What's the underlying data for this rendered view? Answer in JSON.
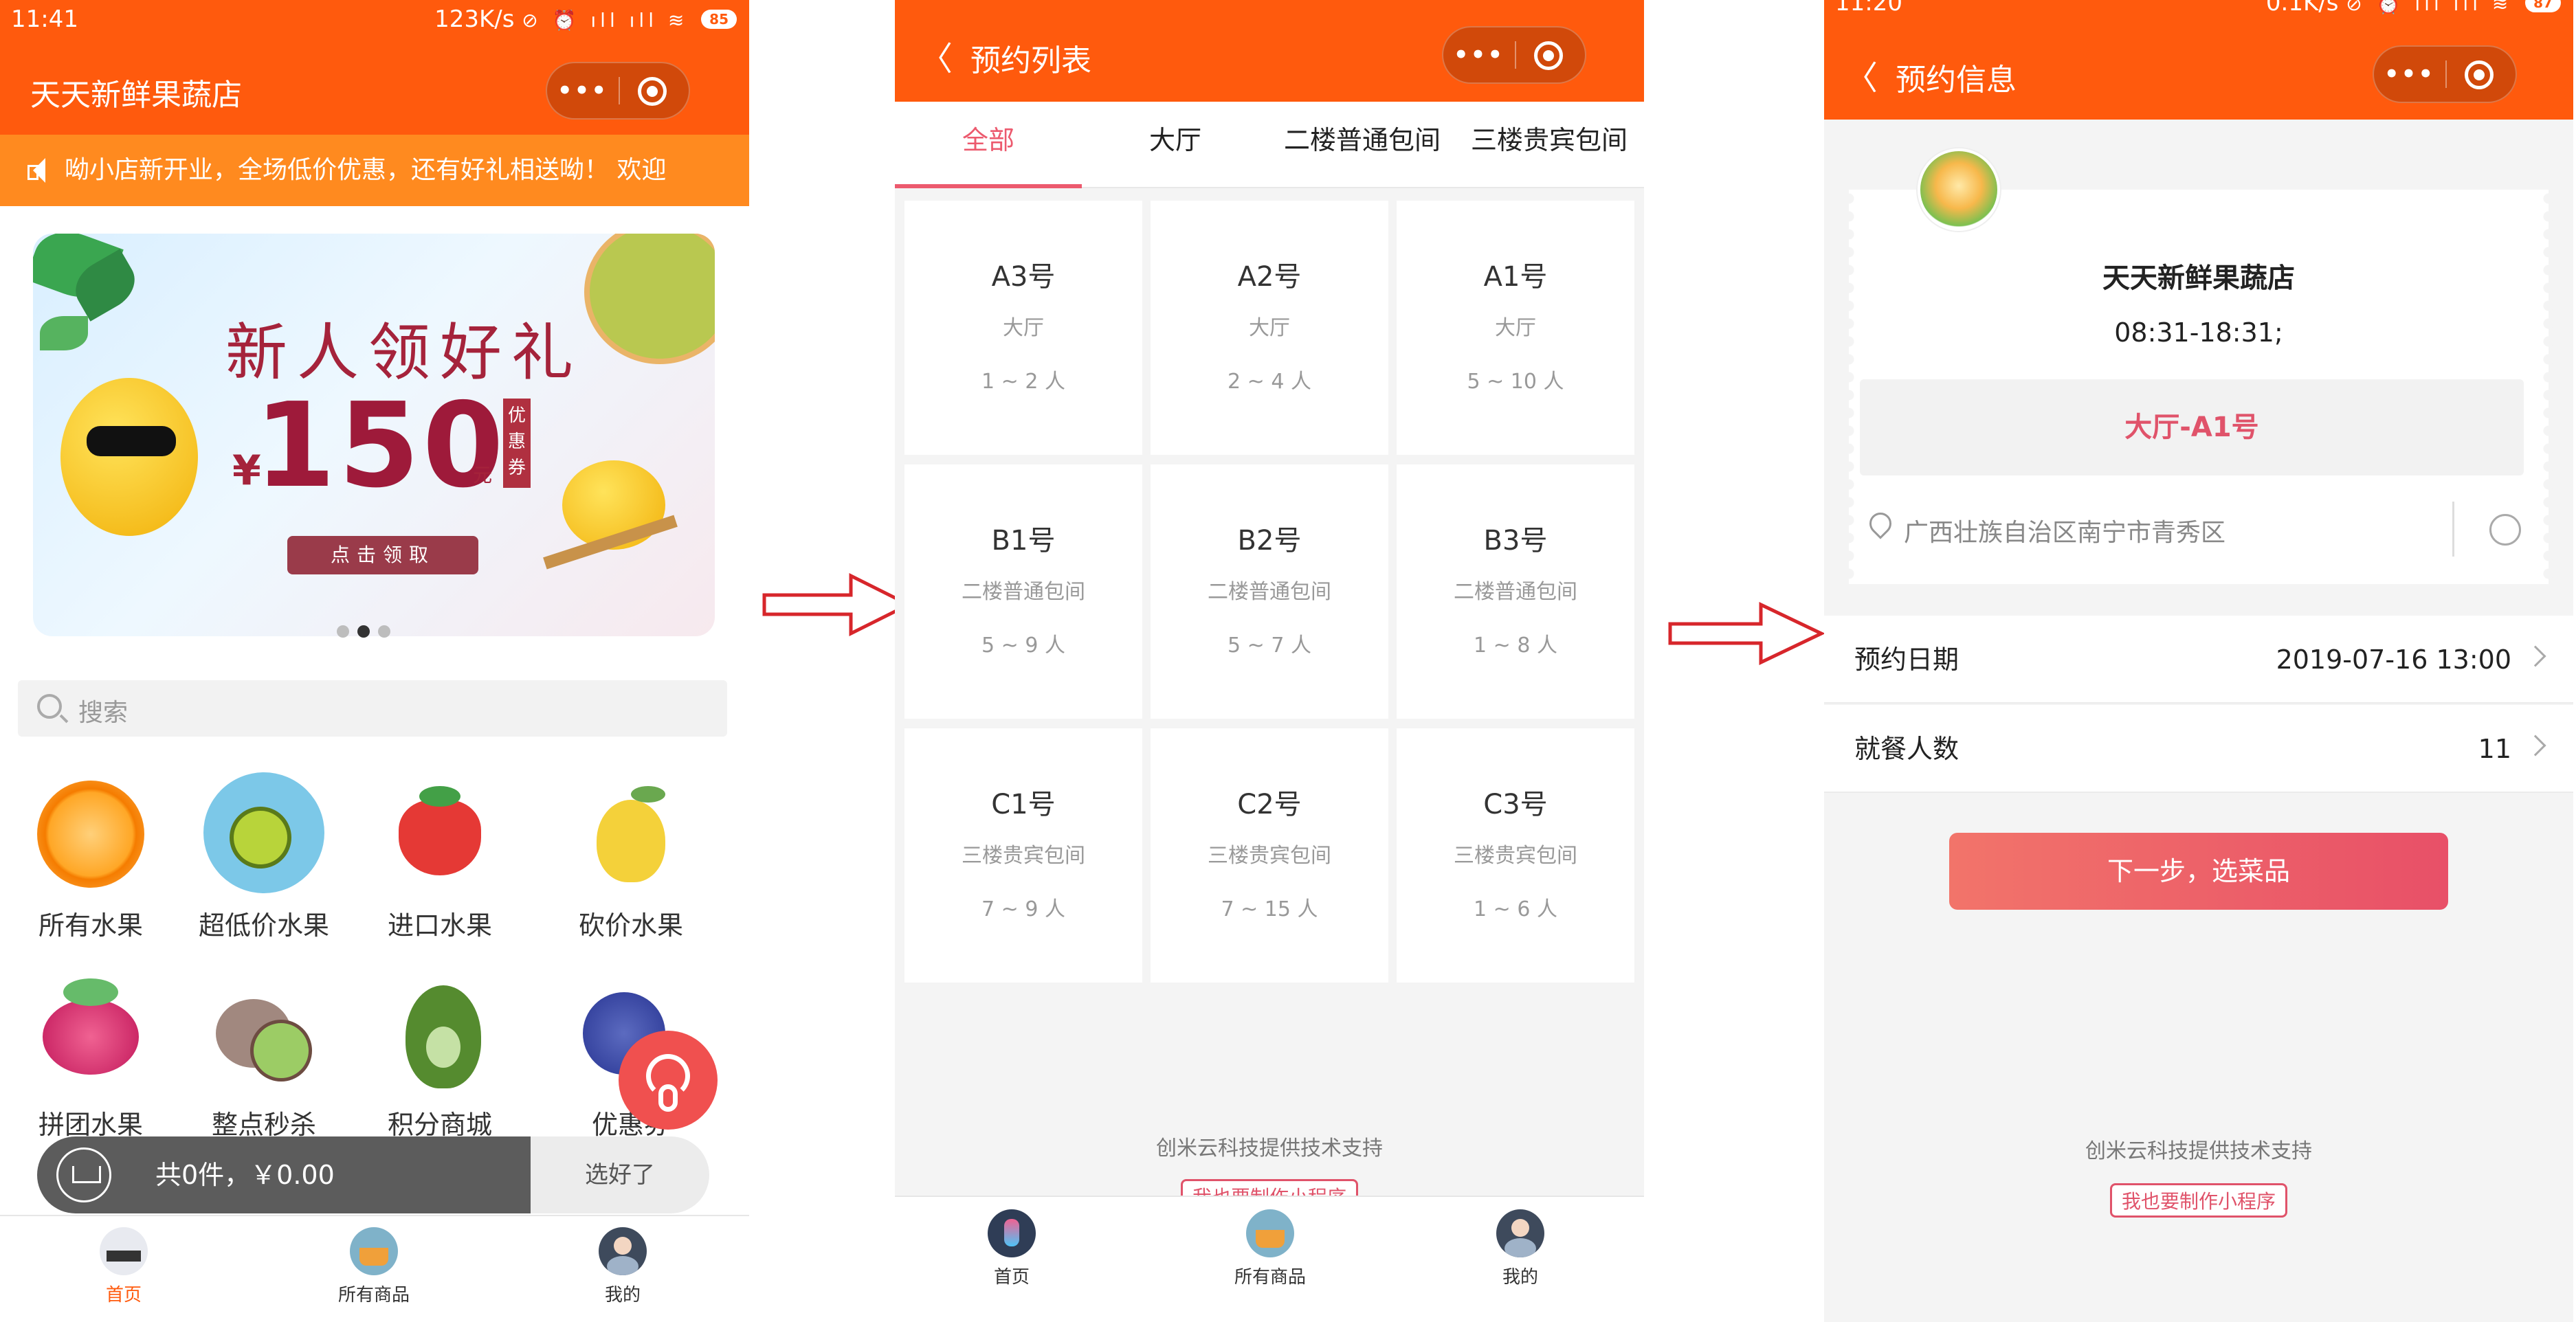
{
  "screen1": {
    "status": {
      "time": "11:41",
      "speed": "123K/s",
      "icons": "⊘ ⏰ ıll ıll ≋",
      "battery": "85"
    },
    "nav_title": "天天新鲜果蔬店",
    "capsule_dots": "•••",
    "notice": "呦小店新开业，全场低价优惠，还有好礼相送呦！ 欢迎",
    "banner": {
      "title": "新人领好礼",
      "currency": "¥",
      "amount": "150",
      "unit": "元",
      "tag": "优惠券",
      "button": "点击领取"
    },
    "search_placeholder": "搜索",
    "categories": [
      "所有水果",
      "超低价水果",
      "进口水果",
      "砍价水果",
      "拼团水果",
      "整点秒杀",
      "积分商城",
      "优惠券"
    ],
    "cart": {
      "summary": "共0件，￥0.00",
      "done": "选好了"
    },
    "tabbar": [
      "首页",
      "所有商品",
      "我的"
    ],
    "colors": {
      "brand": "#ff5a0d",
      "notice": "#ff8a1f",
      "active": "#ff5a0d"
    }
  },
  "screen2": {
    "nav_title": "预约列表",
    "back_icon": "chevron-left-icon",
    "tabs": [
      "全部",
      "大厅",
      "二楼普通包间",
      "三楼贵宾包间"
    ],
    "seats": [
      {
        "name": "A3号",
        "area": "大厅",
        "people": "1 ~ 2 人"
      },
      {
        "name": "A2号",
        "area": "大厅",
        "people": "2 ~ 4 人"
      },
      {
        "name": "A1号",
        "area": "大厅",
        "people": "5 ~ 10 人"
      },
      {
        "name": "B1号",
        "area": "二楼普通包间",
        "people": "5 ~ 9 人"
      },
      {
        "name": "B2号",
        "area": "二楼普通包间",
        "people": "5 ~ 7 人"
      },
      {
        "name": "B3号",
        "area": "二楼普通包间",
        "people": "1 ~ 8 人"
      },
      {
        "name": "C1号",
        "area": "三楼贵宾包间",
        "people": "7 ~ 9 人"
      },
      {
        "name": "C2号",
        "area": "三楼贵宾包间",
        "people": "7 ~ 15 人"
      },
      {
        "name": "C3号",
        "area": "三楼贵宾包间",
        "people": "1 ~ 6 人"
      }
    ],
    "credit": "创米云科技提供技术支持",
    "mini_button": "我也要制作小程序",
    "tabbar": [
      "首页",
      "所有商品",
      "我的"
    ]
  },
  "screen3": {
    "status": {
      "time": "11:20",
      "speed": "0.1K/s",
      "icons": "⊘ ⏰ ıll ıll ≋",
      "battery": "87"
    },
    "nav_title": "预约信息",
    "shop_name": "天天新鲜果蔬店",
    "hours": "08:31-18:31;",
    "seat": "大厅-A1号",
    "address": "广西壮族自治区南宁市青秀区",
    "rows": [
      {
        "label": "预约日期",
        "value": "2019-07-16 13:00"
      },
      {
        "label": "就餐人数",
        "value": "11"
      }
    ],
    "next_button": "下一步，选菜品",
    "credit": "创米云科技提供技术支持",
    "mini_button": "我也要制作小程序",
    "colors": {
      "accent": "#e0536a"
    }
  },
  "arrow_color": "#d7262b"
}
